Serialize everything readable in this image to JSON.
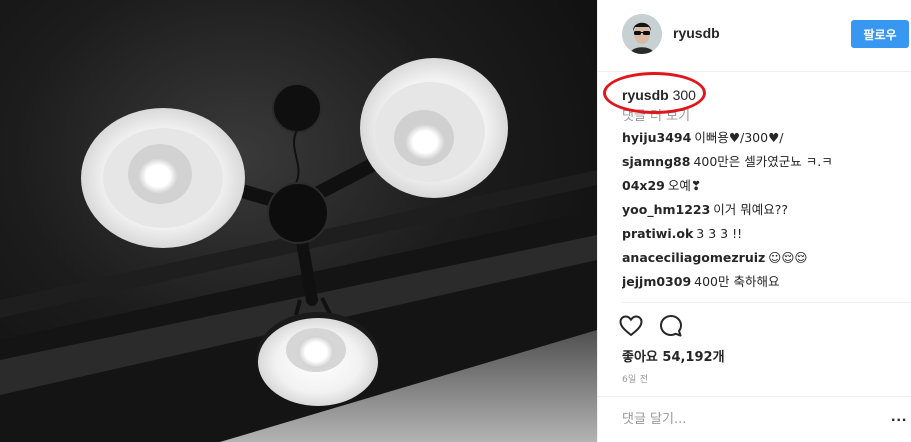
{
  "header": {
    "username": "ryusdb",
    "follow_label": "팔로우"
  },
  "caption": {
    "username": "ryusdb",
    "text": "300"
  },
  "load_more_label": "댓글 더 보기",
  "comments": [
    {
      "user": "hyiju3494",
      "text": "이뻐용♥/300♥/"
    },
    {
      "user": "sjamng88",
      "text": "400만은 셀카였군뇨 ㅋ.ㅋ"
    },
    {
      "user": "04x29",
      "text": "오예❣"
    },
    {
      "user": "yoo_hm1223",
      "text": "이거 뭐예요??"
    },
    {
      "user": "pratiwi.ok",
      "text": "3 3 3 !!"
    },
    {
      "user": "anaceciliagomezruiz",
      "text": "☺😌😌"
    },
    {
      "user": "jejjm0309",
      "text": "400만 축하해요"
    }
  ],
  "actions": {
    "like_icon": "heart-outline-icon",
    "comment_icon": "speech-bubble-icon"
  },
  "likes_label": "좋아요 54,192개",
  "timestamp": "6일 전",
  "add_comment": {
    "placeholder": "댓글 달기...",
    "more_label": "..."
  },
  "colors": {
    "follow_button": "#3897f0",
    "annotation_ring": "#e0161c",
    "muted_text": "#999999"
  }
}
